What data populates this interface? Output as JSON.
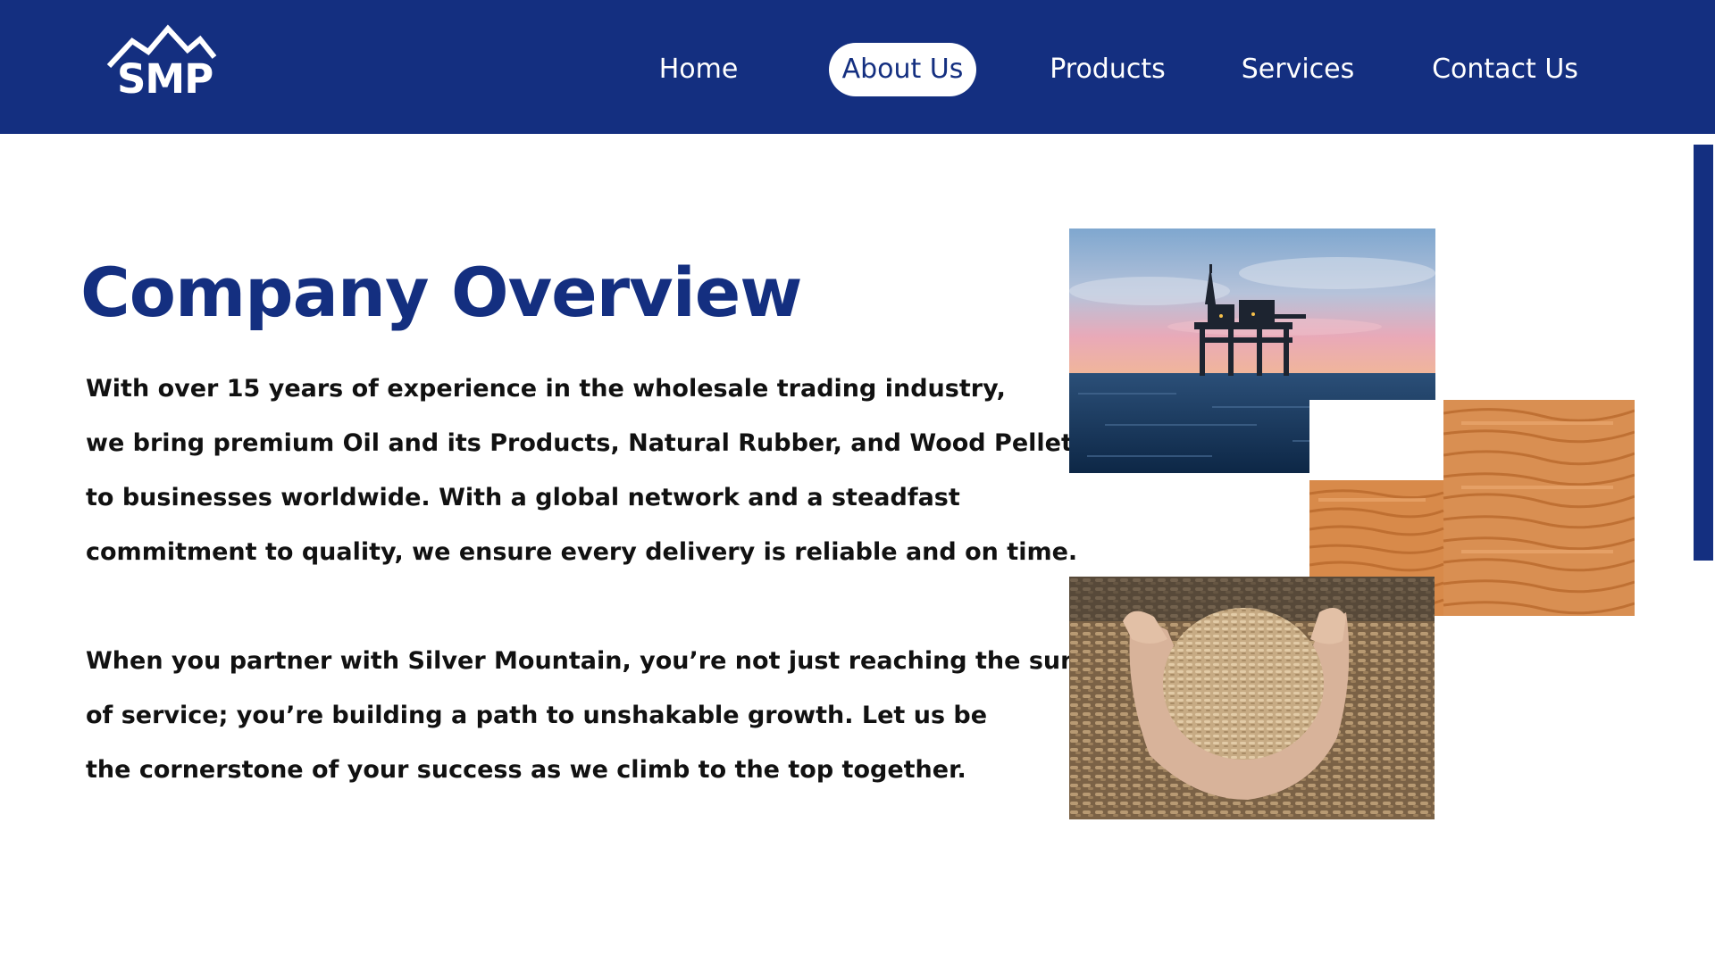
{
  "header": {
    "logo_text": "SMP",
    "nav": [
      {
        "label": "Home",
        "active": false
      },
      {
        "label": "About Us",
        "active": true
      },
      {
        "label": "Products",
        "active": false
      },
      {
        "label": "Services",
        "active": false
      },
      {
        "label": "Contact Us",
        "active": false
      }
    ]
  },
  "main": {
    "title": "Company Overview",
    "paragraph_1": [
      "With over 15 years of experience in the wholesale trading industry,",
      "we bring premium Oil and its Products, Natural Rubber, and Wood Pellets",
      "to businesses worldwide. With a global network and a steadfast",
      "commitment to quality, we ensure every delivery is reliable and on time."
    ],
    "paragraph_2": [
      "When you partner with Silver Mountain, you’re not just reaching the summit",
      "of service; you’re building a path to unshakable growth. Let us be",
      "the cornerstone of your success as we climb to the top together."
    ]
  },
  "images": [
    {
      "name": "offshore-oil-rig-image"
    },
    {
      "name": "natural-rubber-sheets-image"
    },
    {
      "name": "wood-pellets-image"
    }
  ],
  "colors": {
    "brand_navy": "#142f80",
    "text": "#111111",
    "background": "#ffffff"
  }
}
